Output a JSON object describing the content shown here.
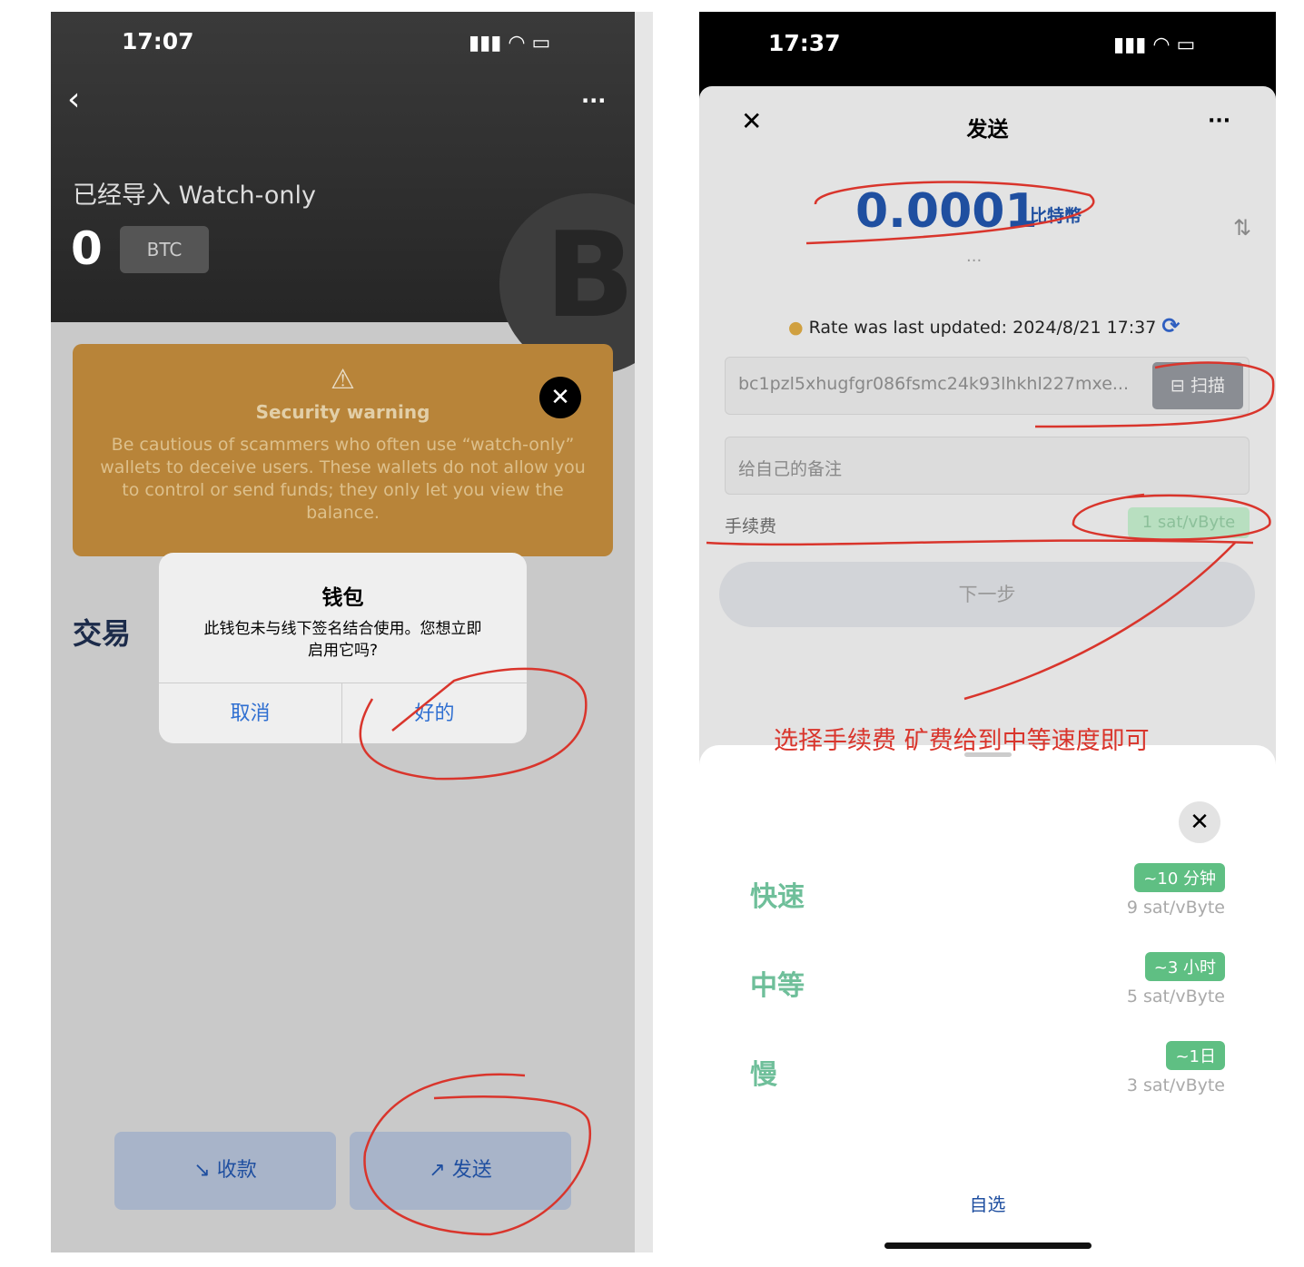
{
  "left": {
    "status_time": "17:07",
    "wallet_title": "已经导入 Watch-only",
    "balance": "0",
    "unit": "BTC",
    "warning": {
      "title": "Security warning",
      "body": "Be cautious of scammers who often use “watch-only” wallets to deceive users. These wallets do not allow you to control or send funds; they only let you view the balance."
    },
    "section_title": "交易",
    "dialog": {
      "title": "钱包",
      "message": "此钱包未与线下签名结合使用。您想立即启用它吗?",
      "cancel": "取消",
      "ok": "好的"
    },
    "receive": "收款",
    "send": "发送"
  },
  "right": {
    "status_time": "17:37",
    "title": "发送",
    "amount": "0.0001",
    "amount_unit": "比特幣",
    "rate_text": "Rate was last updated: 2024/8/21 17:37",
    "address": "bc1pzl5xhugfgr086fsmc24k93lhkhl227mxe...",
    "scan": "扫描",
    "memo_placeholder": "给自己的备注",
    "fee_label": "手续费",
    "fee_value": "1 sat/vByte",
    "next": "下一步",
    "fee_options": [
      {
        "name": "快速",
        "time": "~10 分钟",
        "rate": "9 sat/vByte"
      },
      {
        "name": "中等",
        "time": "~3 小时",
        "rate": "5 sat/vByte"
      },
      {
        "name": "慢",
        "time": "~1日",
        "rate": "3 sat/vByte"
      }
    ],
    "custom": "自选"
  },
  "annotation": {
    "text": "选择手续费 矿费给到中等速度即可",
    "color": "#d9352c"
  },
  "colors": {
    "warning_bg": "#b88439",
    "accent_blue": "#1f4fa0",
    "fee_green": "#5fbf83"
  }
}
